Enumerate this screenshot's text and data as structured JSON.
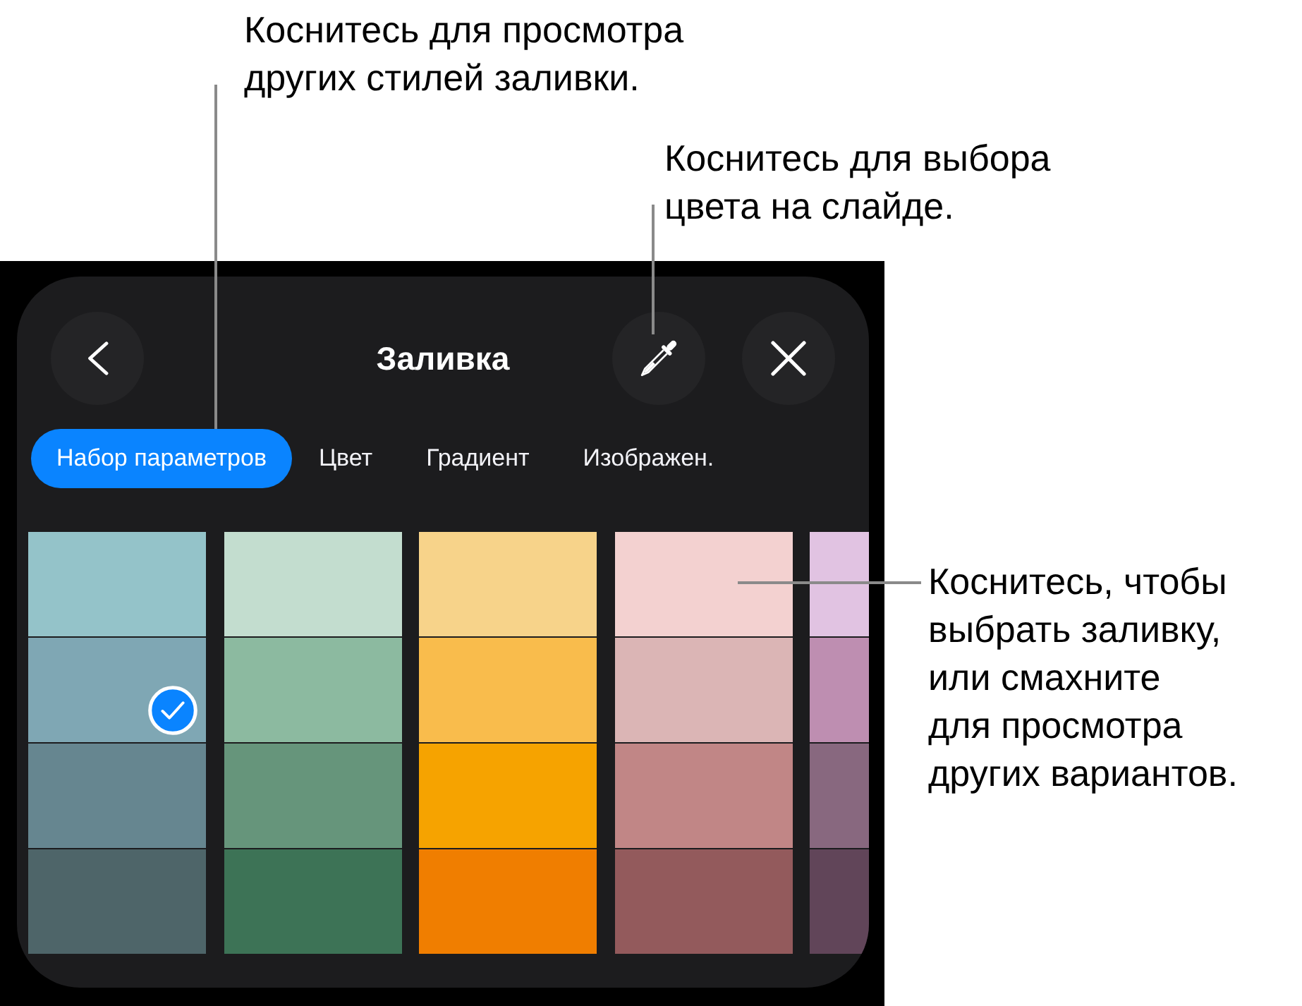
{
  "annotations": [
    {
      "text": "Коснитесь для просмотра\nдругих стилей заливки."
    },
    {
      "text": "Коснитесь для выбора\nцвета на слайде."
    },
    {
      "text": "Коснитесь, чтобы\nвыбрать заливку,\nили смахните\nдля просмотра\nдругих вариантов."
    }
  ],
  "panel": {
    "title": "Заливка",
    "tabs": [
      {
        "label": "Набор параметров",
        "selected": true
      },
      {
        "label": "Цвет",
        "selected": false
      },
      {
        "label": "Градиент",
        "selected": false
      },
      {
        "label": "Изображен.",
        "selected": false
      }
    ],
    "swatch_columns": [
      {
        "swatches": [
          {
            "color": "#94c3c9",
            "selected": false
          },
          {
            "color": "#7fa7b4",
            "selected": true
          },
          {
            "color": "#668690",
            "selected": false
          },
          {
            "color": "#4e6569",
            "selected": false
          }
        ]
      },
      {
        "swatches": [
          {
            "color": "#c3ddcf",
            "selected": false
          },
          {
            "color": "#8cbaa0",
            "selected": false
          },
          {
            "color": "#66957b",
            "selected": false
          },
          {
            "color": "#3d7356",
            "selected": false
          }
        ]
      },
      {
        "swatches": [
          {
            "color": "#f7d38a",
            "selected": false
          },
          {
            "color": "#f9bc4c",
            "selected": false
          },
          {
            "color": "#f6a300",
            "selected": false
          },
          {
            "color": "#f07e00",
            "selected": false
          }
        ]
      },
      {
        "swatches": [
          {
            "color": "#f3d1d0",
            "selected": false
          },
          {
            "color": "#dbb5b5",
            "selected": false
          },
          {
            "color": "#c18686",
            "selected": false
          },
          {
            "color": "#935a5c",
            "selected": false
          }
        ]
      },
      {
        "swatches": [
          {
            "color": "#e1c3e2",
            "selected": false
          },
          {
            "color": "#be8eb1",
            "selected": false
          },
          {
            "color": "#88687f",
            "selected": false
          },
          {
            "color": "#614559",
            "selected": false
          }
        ]
      }
    ]
  }
}
